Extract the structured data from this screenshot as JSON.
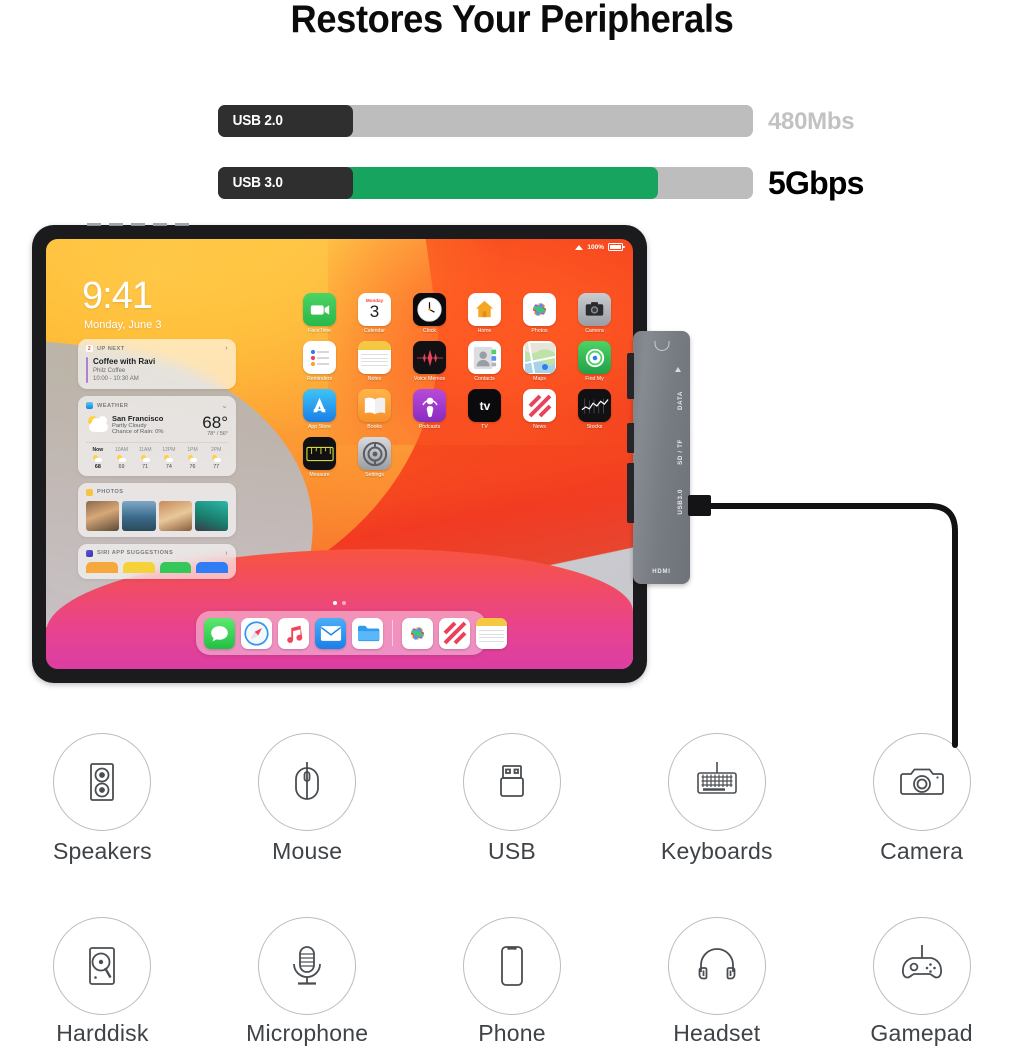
{
  "headline": "Restores Your Peripherals",
  "speed_chart": {
    "type": "bar",
    "title": "USB transfer speed comparison",
    "orientation": "horizontal",
    "categories": [
      "USB 2.0",
      "USB 3.0"
    ],
    "value_labels": [
      "480Mbs",
      "5Gbps"
    ],
    "values": [
      480,
      5000
    ],
    "unit": "Mbps",
    "fill_fractions": [
      0.155,
      0.765
    ],
    "colors": {
      "fill": "#16a45f",
      "track": "#bdbdbd",
      "chip": "#2f2f2f"
    },
    "label_colors": [
      "#c2c2c2",
      "#000000"
    ]
  },
  "tablet": {
    "status": {
      "wifi": "wifi-icon",
      "battery_percent": "100%",
      "battery": "battery-icon"
    },
    "lockscreen": {
      "time": "9:41",
      "date": "Monday, June 3"
    },
    "widgets": {
      "up_next": {
        "header": "UP NEXT",
        "count": "2",
        "event_title": "Coffee with Ravi",
        "event_place": "Philz Coffee",
        "event_time": "10:00 - 10:30 AM"
      },
      "weather": {
        "header": "WEATHER",
        "city": "San Francisco",
        "condition": "Partly Cloudy",
        "rain": "Chance of Rain: 0%",
        "temp": "68°",
        "hilo": "78° / 56°",
        "hours": [
          {
            "label": "Now",
            "temp": "68"
          },
          {
            "label": "10AM",
            "temp": "69"
          },
          {
            "label": "11AM",
            "temp": "71"
          },
          {
            "label": "12PM",
            "temp": "74"
          },
          {
            "label": "1PM",
            "temp": "76"
          },
          {
            "label": "2PM",
            "temp": "77"
          }
        ]
      },
      "photos": {
        "header": "PHOTOS"
      },
      "siri": {
        "header": "SIRI APP SUGGESTIONS"
      }
    },
    "apps": [
      [
        {
          "label": "FaceTime",
          "icon": "facetime-icon"
        },
        {
          "label": "Calendar",
          "icon": "calendar-icon",
          "day": "3",
          "weekday": "Monday"
        },
        {
          "label": "Clock",
          "icon": "clock-icon"
        },
        {
          "label": "Home",
          "icon": "home-icon"
        },
        {
          "label": "Photos",
          "icon": "photos-icon"
        },
        {
          "label": "Camera",
          "icon": "camera-icon"
        }
      ],
      [
        {
          "label": "Reminders",
          "icon": "reminders-icon"
        },
        {
          "label": "Notes",
          "icon": "notes-icon"
        },
        {
          "label": "Voice Memos",
          "icon": "voice-memos-icon"
        },
        {
          "label": "Contacts",
          "icon": "contacts-icon"
        },
        {
          "label": "Maps",
          "icon": "maps-icon"
        },
        {
          "label": "Find My",
          "icon": "find-my-icon"
        }
      ],
      [
        {
          "label": "App Store",
          "icon": "app-store-icon"
        },
        {
          "label": "Books",
          "icon": "books-icon"
        },
        {
          "label": "Podcasts",
          "icon": "podcasts-icon"
        },
        {
          "label": "TV",
          "icon": "tv-icon"
        },
        {
          "label": "News",
          "icon": "news-icon"
        },
        {
          "label": "Stocks",
          "icon": "stocks-icon"
        }
      ],
      [
        {
          "label": "Measure",
          "icon": "measure-icon"
        },
        {
          "label": "Settings",
          "icon": "settings-icon"
        }
      ]
    ],
    "dock": [
      {
        "label": "Messages",
        "icon": "messages-icon"
      },
      {
        "label": "Safari",
        "icon": "safari-icon"
      },
      {
        "label": "Music",
        "icon": "music-icon"
      },
      {
        "label": "Mail",
        "icon": "mail-icon"
      },
      {
        "label": "Files",
        "icon": "files-icon"
      },
      {
        "label": "Photos",
        "icon": "photos-icon"
      },
      {
        "label": "News",
        "icon": "news-icon"
      },
      {
        "label": "Notes",
        "icon": "notes-icon"
      }
    ]
  },
  "hub": {
    "ports": [
      "DATA",
      "SD / TF",
      "USB3.0"
    ],
    "hdmi": "HDMI",
    "usb_symbol": "usb-symbol-icon"
  },
  "peripherals": [
    [
      {
        "label": "Speakers",
        "icon": "speakers-icon"
      },
      {
        "label": "Mouse",
        "icon": "mouse-icon"
      },
      {
        "label": "USB",
        "icon": "usb-drive-icon"
      },
      {
        "label": "Keyboards",
        "icon": "keyboard-icon"
      },
      {
        "label": "Camera",
        "icon": "camera-icon"
      }
    ],
    [
      {
        "label": "Harddisk",
        "icon": "harddisk-icon"
      },
      {
        "label": "Microphone",
        "icon": "microphone-icon"
      },
      {
        "label": "Phone",
        "icon": "phone-icon"
      },
      {
        "label": "Headset",
        "icon": "headset-icon"
      },
      {
        "label": "Gamepad",
        "icon": "gamepad-icon"
      }
    ]
  ]
}
